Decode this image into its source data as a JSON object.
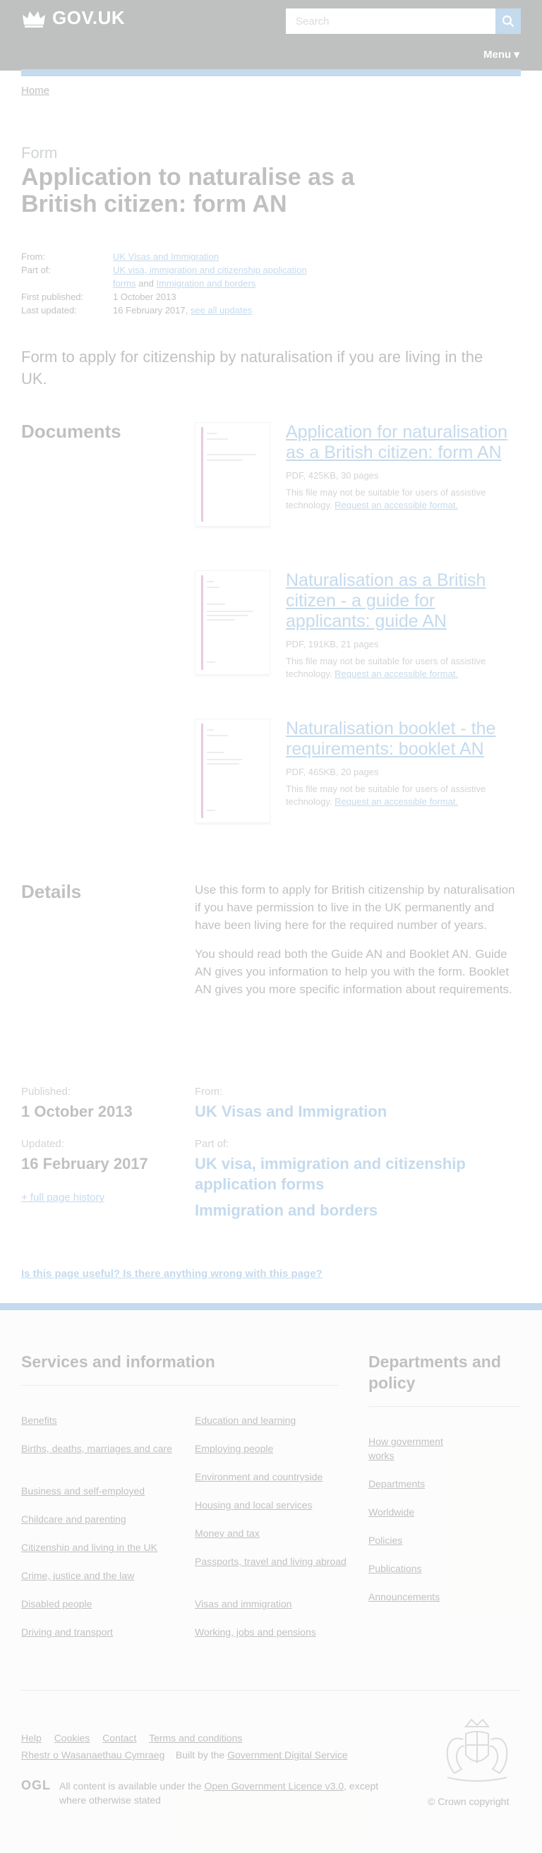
{
  "header": {
    "logo_text": "GOV.UK",
    "search_placeholder": "Search",
    "menu_label": "Menu ▾"
  },
  "breadcrumb": {
    "home": "Home"
  },
  "title": {
    "caption": "Form",
    "heading": "Application to naturalise as a British citizen: form AN"
  },
  "metadata": {
    "from_key": "From:",
    "from_val": "UK Visas and Immigration",
    "part_key": "Part of:",
    "part_link1": "UK visa, immigration and citizenship application forms",
    "part_and": "and",
    "part_link2": "Immigration and borders",
    "first_key": "First published:",
    "first_val": "1 October 2013",
    "updated_key": "Last updated:",
    "updated_val": "16 February 2017,",
    "updated_link": "see all updates"
  },
  "lead": "Form to apply for citizenship by naturalisation if you are living in the UK.",
  "documents": {
    "heading": "Documents",
    "items": [
      {
        "title": "Application for naturalisation as a British citizen: form AN",
        "meta": "PDF, 425KB, 30 pages",
        "note": "This file may not be suitable for users of assistive technology.",
        "request": "Request an accessible format."
      },
      {
        "title": "Naturalisation as a British citizen - a guide for applicants: guide AN",
        "meta": "PDF, 191KB, 21 pages",
        "note": "This file may not be suitable for users of assistive technology.",
        "request": "Request an accessible format."
      },
      {
        "title": "Naturalisation booklet - the requirements: booklet AN",
        "meta": "PDF, 465KB, 20 pages",
        "note": "This file may not be suitable for users of assistive technology.",
        "request": "Request an accessible format."
      }
    ]
  },
  "details": {
    "heading": "Details",
    "p1": "Use this form to apply for British citizenship by naturalisation if you have permission to live in the UK permanently and have been living here for the required number of years.",
    "p2": "You should read both the Guide AN and Booklet AN. Guide AN gives you information to help you with the form. Booklet AN gives you more specific information about requirements."
  },
  "bottom_meta": {
    "published_label": "Published:",
    "published_val": "1 October 2013",
    "updated_label": "Updated:",
    "updated_val": "16 February 2017",
    "history_link": "+ full page history",
    "from_label": "From:",
    "from_val": "UK Visas and Immigration",
    "part_label": "Part of:",
    "part_link1": "UK visa, immigration and citizenship application forms",
    "part_link2": "Immigration and borders"
  },
  "feedback": {
    "link": "Is this page useful? Is there anything wrong with this page?"
  },
  "footer": {
    "services_heading": "Services and information",
    "services_col1": [
      "Benefits",
      "Births, deaths, marriages and care",
      "Business and self-employed",
      "Childcare and parenting",
      "Citizenship and living in the UK",
      "Crime, justice and the law",
      "Disabled people",
      "Driving and transport"
    ],
    "services_col2": [
      "Education and learning",
      "Employing people",
      "Environment and countryside",
      "Housing and local services",
      "Money and tax",
      "Passports, travel and living abroad",
      "Visas and immigration",
      "Working, jobs and pensions"
    ],
    "departments_heading": "Departments and policy",
    "departments": [
      "How government works",
      "Departments",
      "Worldwide",
      "Policies",
      "Publications",
      "Announcements"
    ],
    "meta_links": [
      "Help",
      "Cookies",
      "Contact",
      "Terms and conditions"
    ],
    "welsh": "Rhestr o Wasanaethau Cymraeg",
    "built_by": "Built by the",
    "gds": "Government Digital Service",
    "ogl": "OGL",
    "licence_pre": "All content is available under the",
    "licence_link": "Open Government Licence v3.0",
    "licence_post": ", except where otherwise stated",
    "copyright": "© Crown copyright"
  },
  "colors": {
    "header_bg": "#0b0c0c",
    "link": "#1d70b8",
    "footer_bg": "#f3f2f1",
    "accent_bar": "#1d70b8"
  }
}
